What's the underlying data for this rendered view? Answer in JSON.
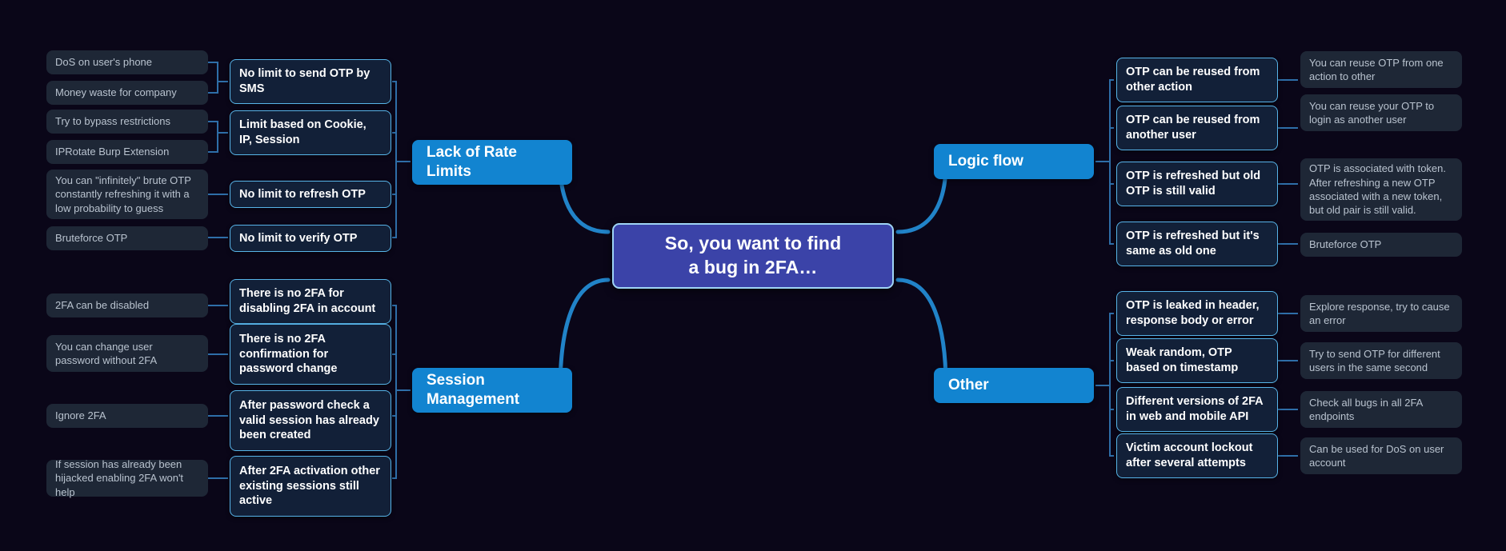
{
  "diagram": {
    "title": "So, you want to find a bug in 2FA...",
    "background_color": "#0a0618",
    "root": {
      "label": "So, you want to find\na bug in 2FA…"
    },
    "branches": [
      {
        "id": "lack-of-rate-limits",
        "label": "Lack of Rate\nLimits",
        "side": "left",
        "color": "#1284d0"
      },
      {
        "id": "session-management",
        "label": "Session\nManagement",
        "side": "left",
        "color": "#1284d0"
      },
      {
        "id": "logic-flow",
        "label": "Logic flow",
        "side": "right",
        "color": "#1284d0"
      },
      {
        "id": "other",
        "label": "Other",
        "side": "right",
        "color": "#1284d0"
      }
    ],
    "topics": {
      "rate_limits": [
        {
          "label": "No limit to send OTP by SMS",
          "notes": [
            "DoS on user's phone",
            "Money waste for company"
          ]
        },
        {
          "label": "Limit based on Cookie, IP, Session",
          "notes": [
            "Try to bypass restrictions",
            "IPRotate Burp Extension"
          ]
        },
        {
          "label": "No limit to refresh OTP",
          "notes": [
            "You can \"infinitely\" brute OTP constantly refreshing it with a low probability to guess"
          ]
        },
        {
          "label": "No limit to verify OTP",
          "notes": [
            "Bruteforce OTP"
          ]
        }
      ],
      "session_management": [
        {
          "label": "There is no 2FA for disabling 2FA in account",
          "notes": [
            "2FA can be disabled"
          ]
        },
        {
          "label": "There is no 2FA confirmation for password change",
          "notes": [
            "You can change user password without 2FA"
          ]
        },
        {
          "label": "After password check a valid session has already been created",
          "notes": [
            "Ignore 2FA"
          ]
        },
        {
          "label": "After 2FA activation other existing sessions still active",
          "notes": [
            "If session has already been hijacked enabling 2FA won't help"
          ]
        }
      ],
      "logic_flow": [
        {
          "label": "OTP can be reused from other action",
          "notes": [
            "You can reuse OTP from one action to other"
          ]
        },
        {
          "label": "OTP can be reused from another user",
          "notes": [
            "You can reuse your OTP to login as another user"
          ]
        },
        {
          "label": "OTP is refreshed but old OTP is still valid",
          "notes": [
            "OTP is associated with token. After refreshing a new OTP associated with a new token, but old pair is still valid."
          ]
        },
        {
          "label": "OTP is refreshed but it's same as old one",
          "notes": [
            "Bruteforce OTP"
          ]
        }
      ],
      "other": [
        {
          "label": "OTP is leaked in header, response body or error",
          "notes": [
            "Explore response, try to cause an error"
          ]
        },
        {
          "label": "Weak random, OTP based on timestamp",
          "notes": [
            "Try to send OTP for different users in the same second"
          ]
        },
        {
          "label": "Different versions of 2FA in web and mobile API",
          "notes": [
            "Check all bugs in all 2FA endpoints"
          ]
        },
        {
          "label": "Victim account lockout after several attempts",
          "notes": [
            "Can be used for DoS on user account"
          ]
        }
      ]
    },
    "colors": {
      "root_fill": "#3b43a8",
      "root_border": "#9fd4f5",
      "branch_fill": "#1284d0",
      "topic_fill": "#122038",
      "topic_border": "#57b4e8",
      "note_fill": "#1e2736",
      "note_text": "#b9c3cf",
      "link": "#2b6fb5"
    }
  }
}
